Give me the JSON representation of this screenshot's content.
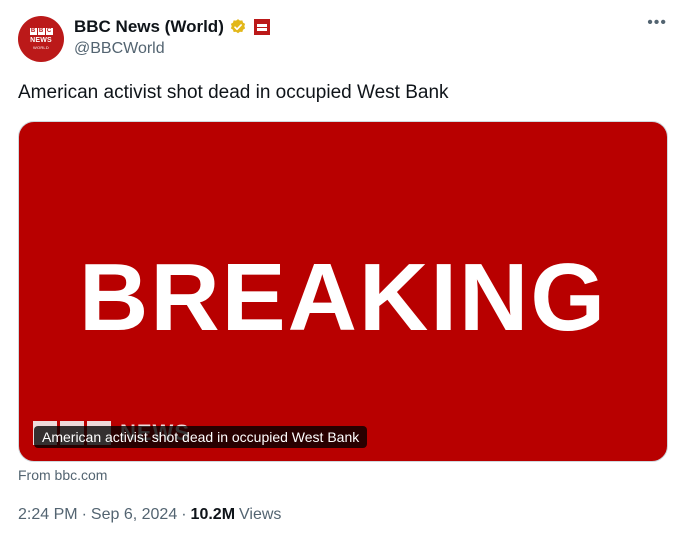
{
  "author": {
    "display_name": "BBC News (World)",
    "handle": "@BBCWorld",
    "verified_icon": "gold-verified-badge",
    "affiliate_icon": "bbc-affiliate-badge",
    "avatar_text": {
      "blocks": [
        "B",
        "B",
        "C"
      ],
      "news": "NEWS",
      "world": "WORLD"
    },
    "brand_color": "#bb1919"
  },
  "more_label": "•••",
  "tweet_text": "American activist shot dead in occupied West Bank",
  "media": {
    "headline": "BREAKING",
    "watermark": "NEWS",
    "caption": "American activist shot dead in occupied West Bank",
    "background_color": "#b80000"
  },
  "source": "From bbc.com",
  "meta": {
    "time": "2:24 PM",
    "separator": "·",
    "date": "Sep 6, 2024",
    "separator2": "·",
    "views_count": "10.2M",
    "views_label": "Views"
  }
}
